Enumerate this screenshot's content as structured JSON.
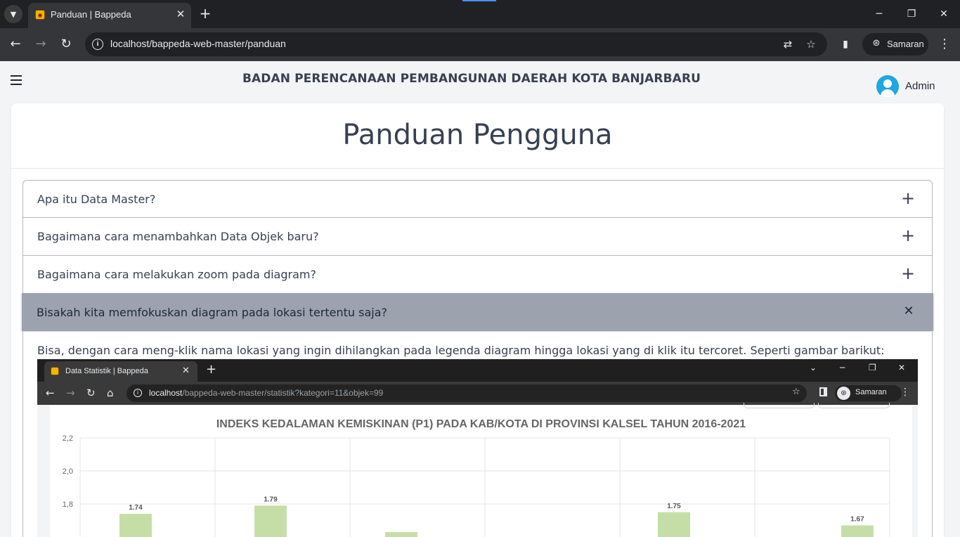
{
  "browser": {
    "tab_title": "Panduan | Bappeda",
    "url": "localhost/bappeda-web-master/panduan",
    "profile_label": "Samaran"
  },
  "header": {
    "site_title": "BADAN PERENCANAAN PEMBANGUNAN DAERAH KOTA BANJARBARU",
    "user_name": "Admin"
  },
  "page": {
    "heading": "Panduan Pengguna"
  },
  "faq": {
    "items": [
      {
        "question": "Apa itu Data Master?",
        "toggle": "+"
      },
      {
        "question": "Bagaimana cara menambahkan Data Objek baru?",
        "toggle": "+"
      },
      {
        "question": "Bagaimana cara melakukan zoom pada diagram?",
        "toggle": "+"
      },
      {
        "question": "Bisakah kita memfokuskan diagram pada lokasi tertentu saja?",
        "toggle": "✕"
      }
    ],
    "open_answer": "Bisa, dengan cara meng-klik nama lokasi yang ingin dihilangkan pada legenda diagram hingga lokasi yang di klik itu tercoret. Seperti gambar barikut:"
  },
  "screenshot": {
    "tab_title": "Data Statistik | Bappeda",
    "url_host": "localhost",
    "url_path": "/bappeda-web-master/statistik?kategori=11&objek=99",
    "profile_label": "Samaran"
  },
  "chart_data": {
    "type": "bar",
    "title": "INDEKS KEDALAMAN KEMISKINAN (P1) PADA KAB/KOTA DI PROVINSI KALSEL TAHUN 2016-2021",
    "y_ticks": [
      "2,2",
      "2,0",
      "1,8"
    ],
    "ylim": [
      1.6,
      2.2
    ],
    "bar_color": "#c5dea8",
    "series": [
      {
        "values": [
          1.74,
          1.79,
          1.63,
          null,
          1.75,
          1.67
        ],
        "labels": [
          "1.74",
          "1.79",
          "",
          "",
          "1.75",
          "1.67"
        ]
      }
    ]
  }
}
